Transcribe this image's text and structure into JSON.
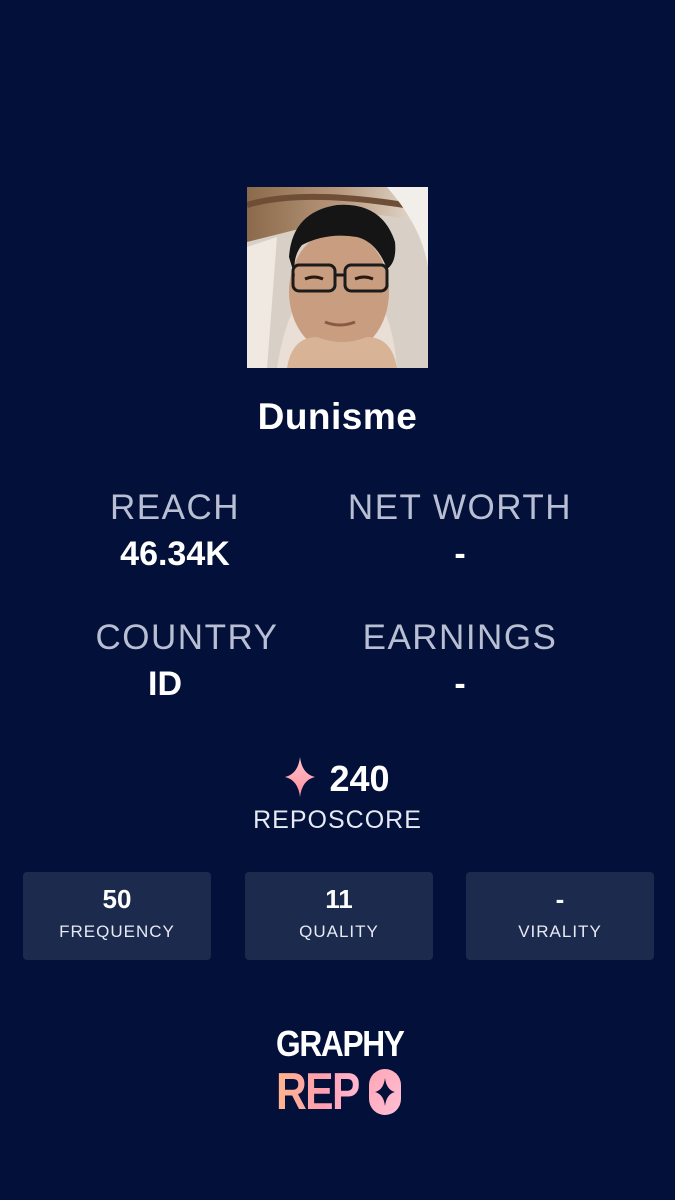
{
  "profile": {
    "username": "Dunisme"
  },
  "stats": {
    "reach": {
      "label": "REACH",
      "value": "46.34K"
    },
    "net_worth": {
      "label": "NET WORTH",
      "value": "-"
    },
    "country": {
      "label": "COUNTRY",
      "value": "ID"
    },
    "earnings": {
      "label": "EARNINGS",
      "value": "-"
    }
  },
  "reposcore": {
    "value": "240",
    "label": "REPOSCORE",
    "icon": "sparkle-icon"
  },
  "metrics": [
    {
      "value": "50",
      "label": "FREQUENCY"
    },
    {
      "value": "11",
      "label": "QUALITY"
    },
    {
      "value": "-",
      "label": "VIRALITY"
    }
  ],
  "logo": {
    "line1": "GRAPHY",
    "line2": "REP"
  },
  "colors": {
    "background": "#03103a",
    "card": "#1b2a4d",
    "label": "#b8bfd3",
    "accent_gradient_start": "#ffb58a",
    "accent_gradient_end": "#ffb8d0"
  }
}
